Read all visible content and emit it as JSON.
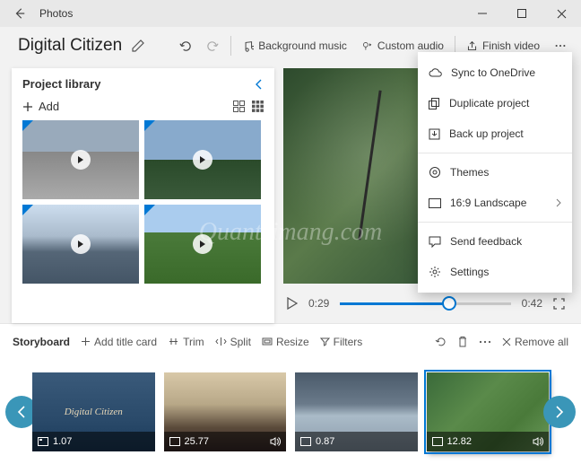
{
  "window": {
    "title": "Photos"
  },
  "project": {
    "name": "Digital Citizen"
  },
  "toolbar": {
    "bg_music": "Background music",
    "custom_audio": "Custom audio",
    "finish": "Finish video"
  },
  "library": {
    "title": "Project library",
    "add": "Add"
  },
  "preview": {
    "current": "0:29",
    "total": "0:42"
  },
  "storyboard": {
    "title": "Storyboard",
    "add_title_card": "Add title card",
    "trim": "Trim",
    "split": "Split",
    "resize": "Resize",
    "filters": "Filters",
    "remove_all": "Remove all",
    "clips": [
      {
        "dur": "1.07",
        "label": "Digital Citizen"
      },
      {
        "dur": "25.77"
      },
      {
        "dur": "0.87"
      },
      {
        "dur": "12.82"
      }
    ]
  },
  "menu": {
    "sync": "Sync to OneDrive",
    "duplicate": "Duplicate project",
    "backup": "Back up project",
    "themes": "Themes",
    "aspect": "16:9 Landscape",
    "feedback": "Send feedback",
    "settings": "Settings"
  },
  "watermark": "Quantrimang.com"
}
